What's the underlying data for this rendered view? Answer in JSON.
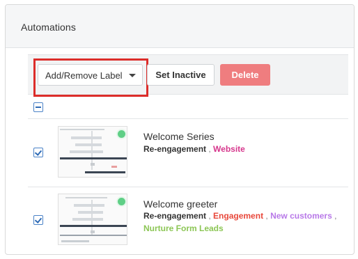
{
  "header": {
    "title": "Automations"
  },
  "toolbar": {
    "dropdown_label": "Add/Remove Label",
    "set_inactive_label": "Set Inactive",
    "delete_label": "Delete"
  },
  "colors": {
    "delete_bg": "#ef7d7f",
    "highlight_border": "#dc2d2a",
    "label_pink": "#d6368c",
    "label_red": "#e8473a",
    "label_purple": "#b879e8",
    "label_green": "#8cc655"
  },
  "automations": [
    {
      "name": "Welcome Series",
      "checked": true,
      "labels": [
        {
          "text": "Re-engagement",
          "color": "#333333"
        },
        {
          "text": "Website",
          "color": "#d6368c"
        }
      ]
    },
    {
      "name": "Welcome greeter",
      "checked": true,
      "labels": [
        {
          "text": "Re-engagement",
          "color": "#333333"
        },
        {
          "text": "Engagement",
          "color": "#e8473a"
        },
        {
          "text": "New customers",
          "color": "#b879e8"
        },
        {
          "text": "Nurture Form Leads",
          "color": "#8cc655"
        }
      ],
      "separators": [
        " , ",
        " , ",
        " ,"
      ]
    }
  ]
}
